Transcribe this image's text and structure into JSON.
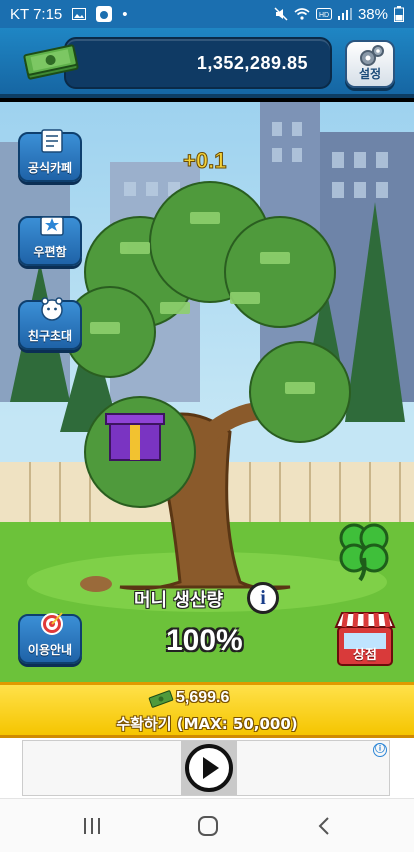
{
  "status_bar": {
    "carrier_time": "KT 7:15",
    "battery": "38%",
    "icons": [
      "gallery-icon",
      "app-notification-icon",
      "dot-icon",
      "mute-icon",
      "wifi-icon",
      "hd-icon",
      "signal-icon",
      "battery-icon"
    ]
  },
  "header": {
    "money_total": "1,352,289.85",
    "settings_label": "설정"
  },
  "side_menu": {
    "cafe_label": "공식카페",
    "mailbox_label": "우편함",
    "invite_label": "친구초대",
    "guide_label": "이용안내"
  },
  "game": {
    "gain_popup": "+0.1",
    "production_label": "머니 생산량",
    "production_percent": "100%",
    "shop_label": "상점"
  },
  "harvest_bar": {
    "amount": "5,699.6",
    "label": "수확하기 (MAX: 50,000)"
  },
  "ad_banner": {
    "info_icon": "ⓘ"
  },
  "colors": {
    "header_blue": "#1f86c4",
    "harvest_yellow": "#f5c500",
    "button_blue": "#2b78c2",
    "shop_red": "#d93a3a"
  }
}
